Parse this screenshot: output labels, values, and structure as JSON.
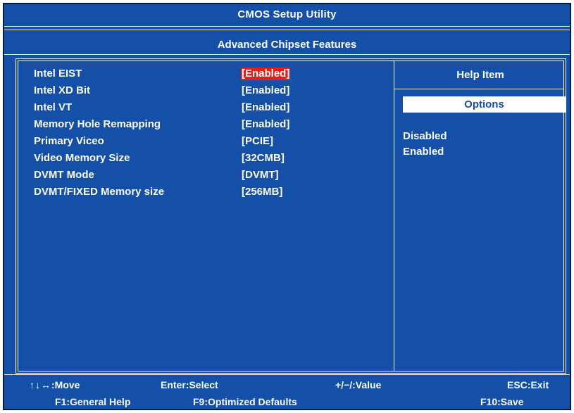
{
  "window": {
    "title": "CMOS Setup Utility"
  },
  "page": {
    "subtitle": "Advanced Chipset Features"
  },
  "settings": [
    {
      "label": "Intel EIST",
      "value": "[Enabled]",
      "selected": true
    },
    {
      "label": "Intel XD Bit",
      "value": "[Enabled]"
    },
    {
      "label": "Intel VT",
      "value": "[Enabled]"
    },
    {
      "label": "Memory Hole Remapping",
      "value": "[Enabled]"
    },
    {
      "label": "Primary Viceo",
      "value": "[PCIE]"
    },
    {
      "label": "Video Memory Size",
      "value": "[32CMB]"
    },
    {
      "label": "DVMT Mode",
      "value": "[DVMT]"
    },
    {
      "label": "DVMT/FIXED Memory size",
      "value": "[256MB]"
    }
  ],
  "help": {
    "title": "Help Item",
    "options_header": "Options",
    "options": [
      "Disabled",
      "Enabled"
    ]
  },
  "footer": {
    "move_icon": "↑↓↔",
    "move": ":Move",
    "select": "Enter:Select",
    "value": "+/−/:Value",
    "exit": "ESC:Exit",
    "help": "F1:General Help",
    "defaults": "F9:Optimized Defaults",
    "save": "F10:Save"
  },
  "colors": {
    "background": "#1450a8",
    "selected_value": "#e0201c",
    "text": "#ffffff"
  }
}
